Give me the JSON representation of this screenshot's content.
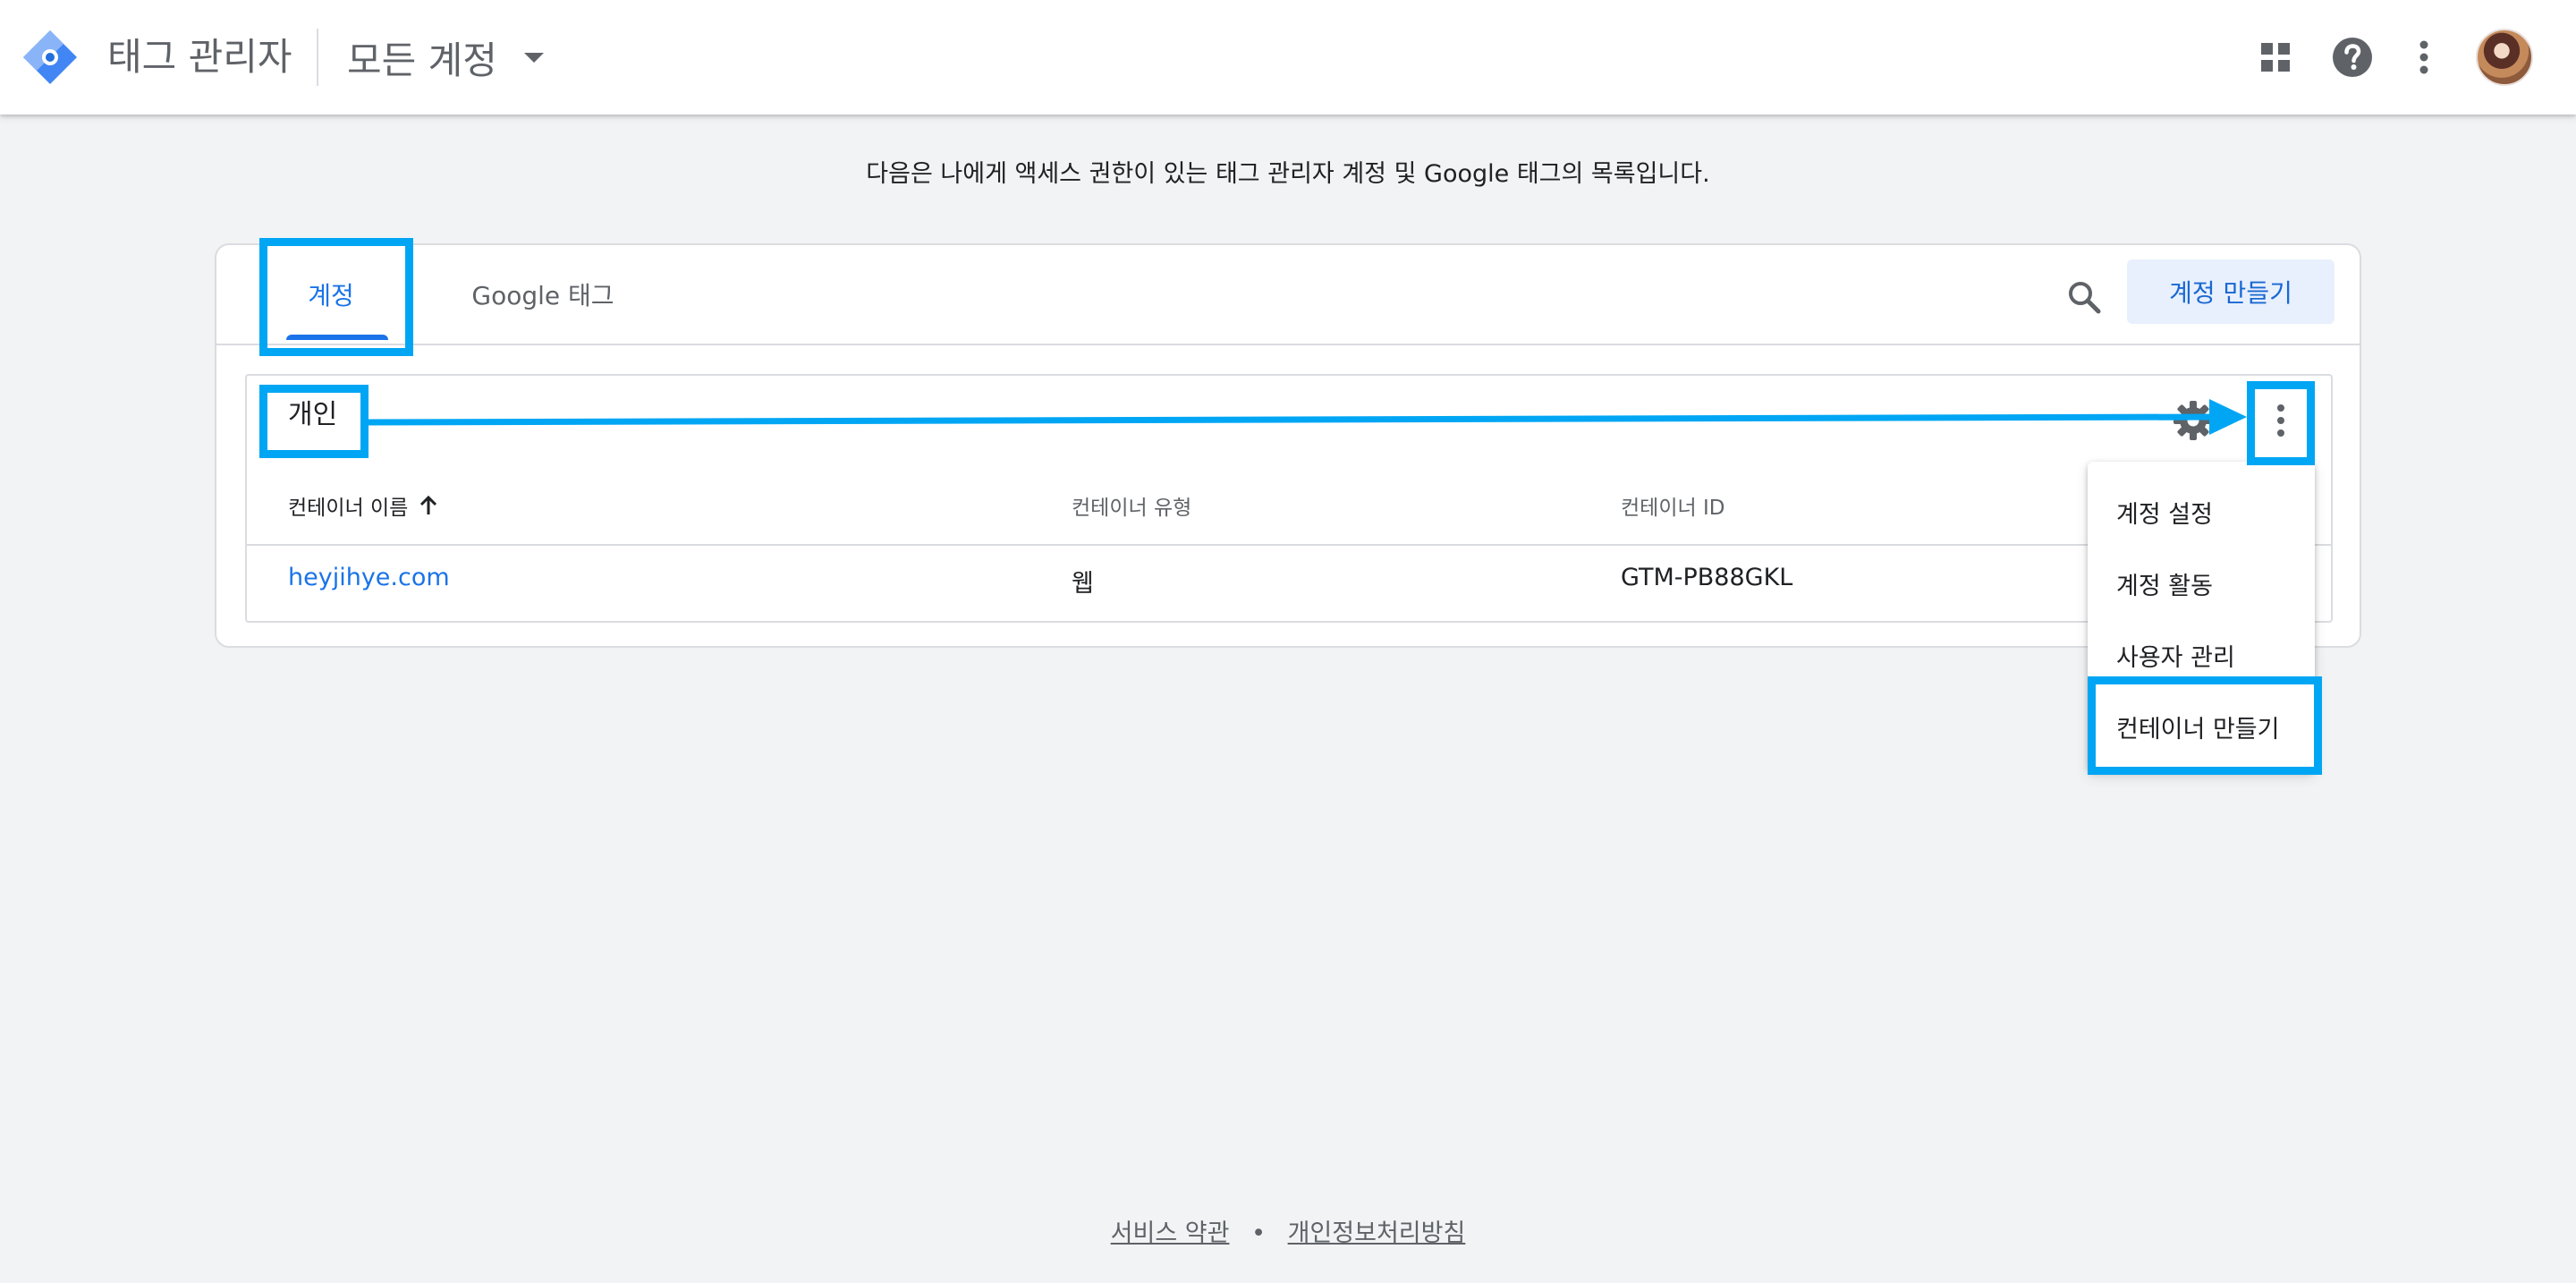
{
  "appbar": {
    "product_name": "태그 관리자",
    "account_switcher_label": "모든 계정",
    "icons": [
      "apps-grid-icon",
      "help-icon",
      "more-vert-icon"
    ]
  },
  "intro": "다음은 나에게 액세스 권한이 있는 태그 관리자 계정 및 Google 태그의 목록입니다.",
  "tabs": [
    {
      "label": "계정",
      "active": true
    },
    {
      "label": "Google 태그",
      "active": false
    }
  ],
  "create_account_label": "계정 만들기",
  "account": {
    "name": "개인",
    "columns": [
      "컨테이너 이름",
      "컨테이너 유형",
      "컨테이너 ID"
    ],
    "rows": [
      {
        "name": "heyjihye.com",
        "type": "웹",
        "id": "GTM-PB88GKL"
      }
    ]
  },
  "menu": {
    "items": [
      "계정 설정",
      "계정 활동",
      "사용자 관리",
      "컨테이너 만들기"
    ]
  },
  "footer": {
    "terms": "서비스 약관",
    "separator": "•",
    "privacy": "개인정보처리방침"
  },
  "colors": {
    "accent": "#1a73e8",
    "annotation": "#00a6f4",
    "background": "#f1f3f4"
  }
}
